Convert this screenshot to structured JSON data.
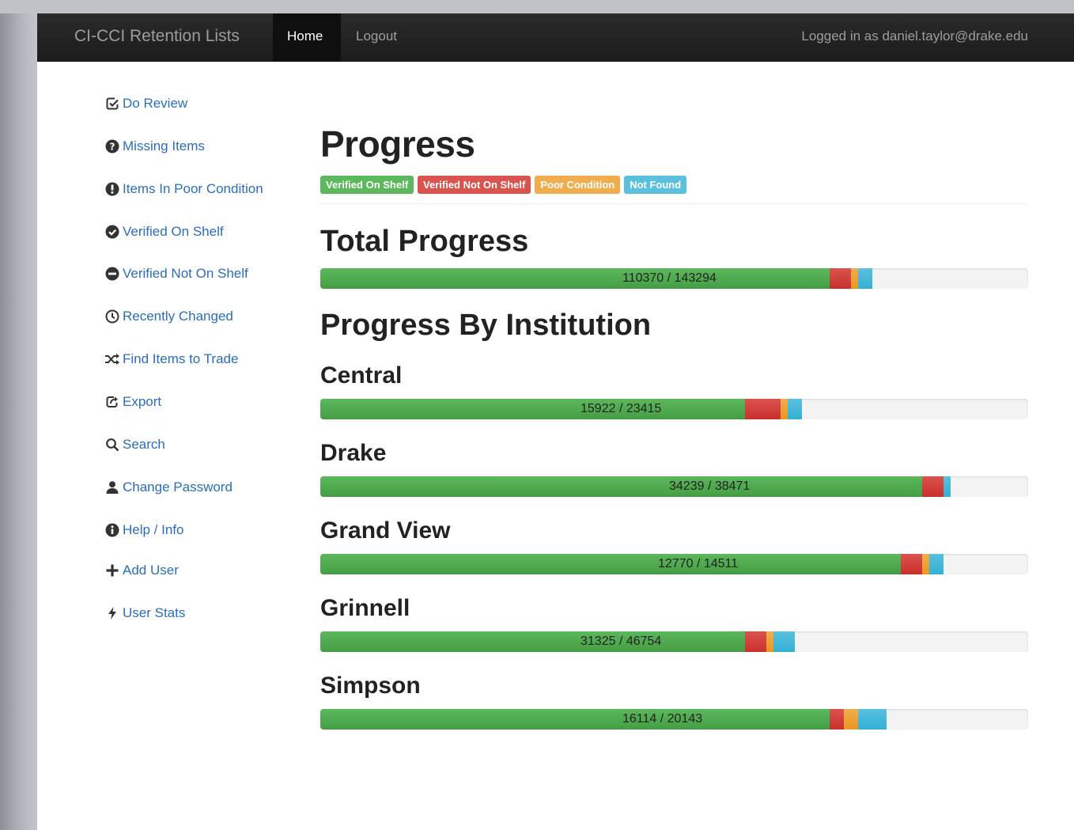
{
  "navbar": {
    "brand": "CI-CCI Retention Lists",
    "home": "Home",
    "logout": "Logout",
    "logged_in": "Logged in as daniel.taylor@drake.edu"
  },
  "sidebar": {
    "items": [
      {
        "label": "Do Review",
        "icon": "check-square-icon"
      },
      {
        "label": "Missing Items",
        "icon": "question-circle-icon"
      },
      {
        "label": "Items In Poor Condition",
        "icon": "exclamation-circle-icon"
      },
      {
        "label": "Verified On Shelf",
        "icon": "check-circle-icon"
      },
      {
        "label": "Verified Not On Shelf",
        "icon": "minus-circle-icon"
      },
      {
        "label": "Recently Changed",
        "icon": "clock-icon"
      },
      {
        "label": "Find Items to Trade",
        "icon": "random-icon"
      },
      {
        "label": "Export",
        "icon": "share-icon"
      },
      {
        "label": "Search",
        "icon": "search-icon"
      },
      {
        "label": "Change Password",
        "icon": "user-icon"
      },
      {
        "label": "Help / Info",
        "icon": "info-circle-icon"
      },
      {
        "label": "Add User",
        "icon": "plus-icon"
      },
      {
        "label": "User Stats",
        "icon": "flash-icon"
      }
    ]
  },
  "main": {
    "title": "Progress",
    "legend": [
      {
        "label": "Verified On Shelf",
        "color": "#5cb85c"
      },
      {
        "label": "Verified Not On Shelf",
        "color": "#d9534f"
      },
      {
        "label": "Poor Condition",
        "color": "#f0ad4e"
      },
      {
        "label": "Not Found",
        "color": "#5bc0de"
      }
    ],
    "total_title": "Total Progress",
    "institution_title": "Progress By Institution",
    "total": {
      "label": "110370 / 143294",
      "verified": 0.72,
      "not_on_shelf": 0.03,
      "poor": 0.01,
      "not_found": 0.02
    },
    "institutions": [
      {
        "name": "Central",
        "label": "15922 / 23415",
        "verified": 0.6,
        "not_on_shelf": 0.05,
        "poor": 0.01,
        "not_found": 0.02
      },
      {
        "name": "Drake",
        "label": "34239 / 38471",
        "verified": 0.85,
        "not_on_shelf": 0.03,
        "poor": 0.0,
        "not_found": 0.01
      },
      {
        "name": "Grand View",
        "label": "12770 / 14511",
        "verified": 0.82,
        "not_on_shelf": 0.03,
        "poor": 0.01,
        "not_found": 0.02
      },
      {
        "name": "Grinnell",
        "label": "31325 / 46754",
        "verified": 0.6,
        "not_on_shelf": 0.03,
        "poor": 0.01,
        "not_found": 0.03
      },
      {
        "name": "Simpson",
        "label": "16114 / 20143",
        "verified": 0.72,
        "not_on_shelf": 0.02,
        "poor": 0.02,
        "not_found": 0.04
      }
    ]
  }
}
